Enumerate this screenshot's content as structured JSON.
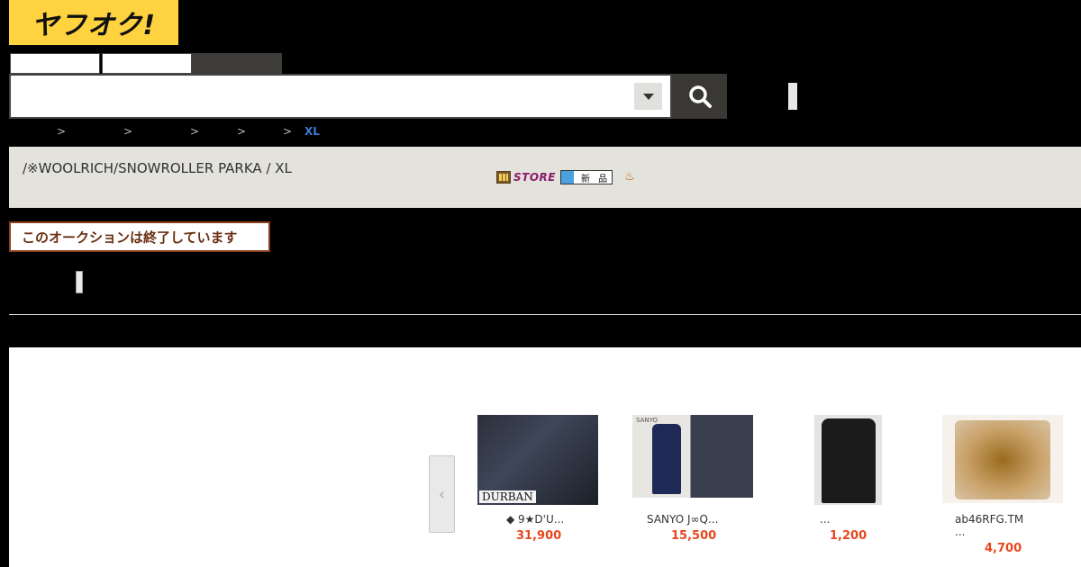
{
  "header": {
    "logo_text": "ヤフオク!",
    "tabs": [
      "",
      "",
      ""
    ],
    "search": {
      "value": "",
      "placeholder": ""
    }
  },
  "breadcrumb": {
    "separators": [
      ">",
      ">",
      ">",
      ">",
      ">"
    ],
    "current": "XL"
  },
  "listing": {
    "title": "/※WOOLRICH/SNOWROLLER PARKA / XL",
    "store_badge": "STORE",
    "new_badge": "新 品",
    "status": "このオークションは終了しています"
  },
  "recommend": {
    "items": [
      {
        "title": "◆ 9★D'U...",
        "price": "31,900",
        "img_text": "DURBAN"
      },
      {
        "title": "SANYO J∞Q...",
        "price": "15,500",
        "img_text": "SANYO"
      },
      {
        "title": "...",
        "price": "1,200"
      },
      {
        "title": "ab46RFG.TM\n...",
        "price": "4,700"
      }
    ]
  },
  "colors": {
    "logo_bg": "#ffd23f",
    "price": "#e8471e",
    "status_border": "#8a3e1b",
    "breadcrumb_current": "#3a7bd5"
  },
  "icons": [
    "search-icon",
    "dropdown-arrow-icon",
    "store-icon",
    "new-icon",
    "gift-icon",
    "chevron-left-icon"
  ]
}
